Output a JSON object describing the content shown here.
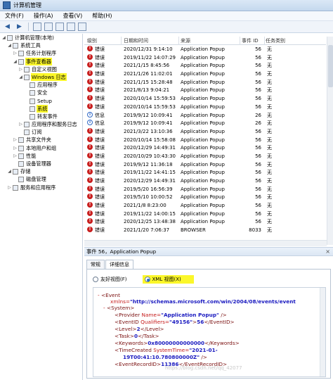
{
  "window": {
    "title": "计算机管理"
  },
  "menu": [
    "文件(F)",
    "操作(A)",
    "查看(V)",
    "帮助(H)"
  ],
  "tree": [
    {
      "label": "计算机管理(本地)",
      "expander": "◢",
      "indent": 0,
      "highlight": false
    },
    {
      "label": "系统工具",
      "expander": "◢",
      "indent": 1,
      "highlight": false
    },
    {
      "label": "任务计划程序",
      "expander": "▷",
      "indent": 2,
      "highlight": false
    },
    {
      "label": "事件查看器",
      "expander": "◢",
      "indent": 2,
      "highlight": true
    },
    {
      "label": "自定义视图",
      "expander": "▷",
      "indent": 3,
      "highlight": false
    },
    {
      "label": "Windows 日志",
      "expander": "◢",
      "indent": 3,
      "highlight": true
    },
    {
      "label": "应用程序",
      "expander": "",
      "indent": 4,
      "highlight": false
    },
    {
      "label": "安全",
      "expander": "",
      "indent": 4,
      "highlight": false
    },
    {
      "label": "Setup",
      "expander": "",
      "indent": 4,
      "highlight": false
    },
    {
      "label": "系统",
      "expander": "",
      "indent": 4,
      "highlight": true
    },
    {
      "label": "转发事件",
      "expander": "",
      "indent": 4,
      "highlight": false
    },
    {
      "label": "应用程序和服务日志",
      "expander": "▷",
      "indent": 3,
      "highlight": false
    },
    {
      "label": "订阅",
      "expander": "",
      "indent": 3,
      "highlight": false
    },
    {
      "label": "共享文件夹",
      "expander": "▷",
      "indent": 2,
      "highlight": false
    },
    {
      "label": "本地用户和组",
      "expander": "▷",
      "indent": 2,
      "highlight": false
    },
    {
      "label": "性能",
      "expander": "▷",
      "indent": 2,
      "highlight": false
    },
    {
      "label": "设备管理器",
      "expander": "",
      "indent": 2,
      "highlight": false
    },
    {
      "label": "存储",
      "expander": "◢",
      "indent": 1,
      "highlight": false
    },
    {
      "label": "磁盘管理",
      "expander": "",
      "indent": 2,
      "highlight": false
    },
    {
      "label": "服务和应用程序",
      "expander": "▷",
      "indent": 1,
      "highlight": false
    }
  ],
  "list": {
    "columns": [
      "级别",
      "日期和时间",
      "来源",
      "事件 ID",
      "任务类别"
    ],
    "rows": [
      {
        "level": "error",
        "level_text": "错误",
        "datetime": "2020/12/31 9:14:10",
        "source": "Application Popup",
        "event_id": "56",
        "category": "无"
      },
      {
        "level": "error",
        "level_text": "错误",
        "datetime": "2019/11/22 14:07:29",
        "source": "Application Popup",
        "event_id": "56",
        "category": "无"
      },
      {
        "level": "error",
        "level_text": "错误",
        "datetime": "2021/1/15 8:45:56",
        "source": "Application Popup",
        "event_id": "56",
        "category": "无"
      },
      {
        "level": "error",
        "level_text": "错误",
        "datetime": "2021/1/26 11:02:01",
        "source": "Application Popup",
        "event_id": "56",
        "category": "无"
      },
      {
        "level": "error",
        "level_text": "错误",
        "datetime": "2021/1/15 15:28:48",
        "source": "Application Popup",
        "event_id": "56",
        "category": "无"
      },
      {
        "level": "error",
        "level_text": "错误",
        "datetime": "2021/8/13 9:04:21",
        "source": "Application Popup",
        "event_id": "56",
        "category": "无"
      },
      {
        "level": "error",
        "level_text": "错误",
        "datetime": "2020/10/14 15:59:53",
        "source": "Application Popup",
        "event_id": "56",
        "category": "无"
      },
      {
        "level": "error",
        "level_text": "错误",
        "datetime": "2020/10/14 15:59:53",
        "source": "Application Popup",
        "event_id": "56",
        "category": "无"
      },
      {
        "level": "info",
        "level_text": "信息",
        "datetime": "2019/9/12 10:09:41",
        "source": "Application Popup",
        "event_id": "26",
        "category": "无"
      },
      {
        "level": "info",
        "level_text": "信息",
        "datetime": "2019/9/12 10:09:41",
        "source": "Application Popup",
        "event_id": "26",
        "category": "无"
      },
      {
        "level": "error",
        "level_text": "错误",
        "datetime": "2021/3/22 13:10:36",
        "source": "Application Popup",
        "event_id": "56",
        "category": "无"
      },
      {
        "level": "error",
        "level_text": "错误",
        "datetime": "2020/10/14 15:58:08",
        "source": "Application Popup",
        "event_id": "56",
        "category": "无"
      },
      {
        "level": "error",
        "level_text": "错误",
        "datetime": "2020/12/29 14:49:31",
        "source": "Application Popup",
        "event_id": "56",
        "category": "无"
      },
      {
        "level": "error",
        "level_text": "错误",
        "datetime": "2020/10/29 10:43:30",
        "source": "Application Popup",
        "event_id": "56",
        "category": "无"
      },
      {
        "level": "error",
        "level_text": "错误",
        "datetime": "2019/9/12 11:36:18",
        "source": "Application Popup",
        "event_id": "56",
        "category": "无"
      },
      {
        "level": "error",
        "level_text": "错误",
        "datetime": "2019/11/22 14:41:15",
        "source": "Application Popup",
        "event_id": "56",
        "category": "无"
      },
      {
        "level": "error",
        "level_text": "错误",
        "datetime": "2020/12/29 14:49:31",
        "source": "Application Popup",
        "event_id": "56",
        "category": "无"
      },
      {
        "level": "error",
        "level_text": "错误",
        "datetime": "2019/5/20 16:56:39",
        "source": "Application Popup",
        "event_id": "56",
        "category": "无"
      },
      {
        "level": "error",
        "level_text": "错误",
        "datetime": "2019/5/10 10:00:52",
        "source": "Application Popup",
        "event_id": "56",
        "category": "无"
      },
      {
        "level": "error",
        "level_text": "错误",
        "datetime": "2021/1/8 8:23:00",
        "source": "Application Popup",
        "event_id": "56",
        "category": "无"
      },
      {
        "level": "error",
        "level_text": "错误",
        "datetime": "2019/11/22 14:00:15",
        "source": "Application Popup",
        "event_id": "56",
        "category": "无"
      },
      {
        "level": "error",
        "level_text": "错误",
        "datetime": "2020/12/25 13:48:38",
        "source": "Application Popup",
        "event_id": "56",
        "category": "无"
      },
      {
        "level": "error",
        "level_text": "错误",
        "datetime": "2021/1/20 7:06:37",
        "source": "BROWSER",
        "event_id": "8033",
        "category": "无"
      }
    ]
  },
  "detail": {
    "title": "事件 56，Application Popup",
    "close": "×",
    "tabs": [
      "常规",
      "详细信息"
    ],
    "radio_friendly": "友好视图(F)",
    "radio_xml": "XML 视图(X)",
    "xml": {
      "event_open": "<Event",
      "xmlns_attr": "xmlns=",
      "xmlns_val": "\"http://schemas.microsoft.com/win/2004/08/events/event",
      "system_open": "<System>",
      "provider_tag": "<Provider",
      "provider_attr": "Name=",
      "provider_val": "\"Application Popup\"",
      "provider_close": "/>",
      "eventid_tag": "<EventID",
      "eventid_attr": "Qualifiers=",
      "eventid_val": "\"49156\"",
      "eventid_mid": ">",
      "eventid_content": "56",
      "eventid_close": "</EventID>",
      "level_open": "<Level>",
      "level_val": "2",
      "level_close": "</Level>",
      "task_open": "<Task>",
      "task_val": "0",
      "task_close": "</Task>",
      "keywords_open": "<Keywords>",
      "keywords_val": "0x80000000000000",
      "keywords_close": "</Keywords>",
      "timecreated_tag": "<TimeCreated",
      "timecreated_attr": "SystemTime=",
      "timecreated_val1": "\"2021-01-",
      "timecreated_val2": "19T00:41:10.780800000Z\"",
      "timecreated_close": "/>",
      "recordid_open": "<EventRecordID>",
      "recordid_val": "11386",
      "recordid_close": "</EventRecordID>",
      "minus": "-"
    }
  },
  "watermark": "https://blog.csdn.net/qq_42077"
}
